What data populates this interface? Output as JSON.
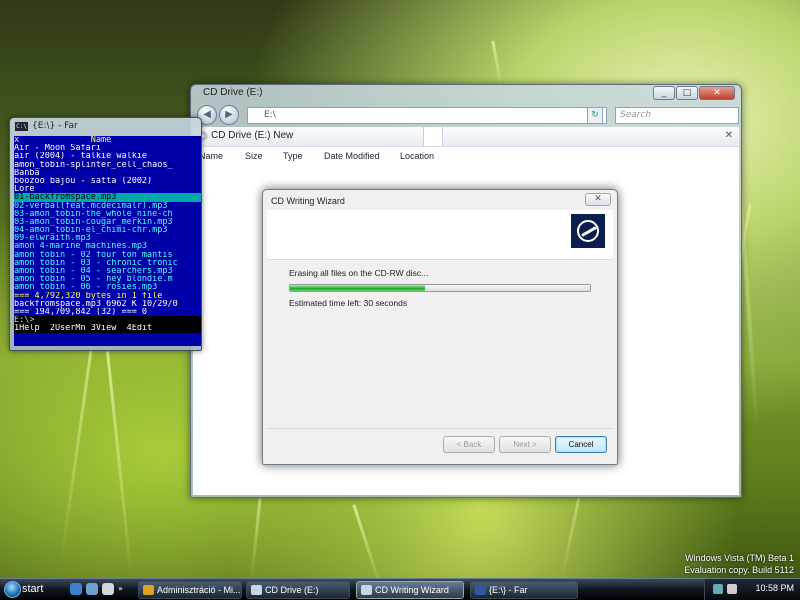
{
  "desktop": {
    "watermark_line1": "Windows Vista (TM) Beta 1",
    "watermark_line2": "Evaluation copy. Build 5112"
  },
  "explorer": {
    "title": "CD Drive (E:)",
    "address": "E:\\",
    "search_placeholder": "Search",
    "toolbar_label": "CD Drive (E:) New",
    "columns": [
      "Name",
      "Size",
      "Type",
      "Date Modified",
      "Location"
    ],
    "controls": {
      "minimize": "_",
      "maximize": "□",
      "close": "✕",
      "back": "◀",
      "forward": "▶",
      "refresh": "↻"
    }
  },
  "far": {
    "title": "{E:\\} - Far",
    "icon_text": "C:\\",
    "lines": [
      {
        "text": "x              Name           ",
        "style": "yellow"
      },
      {
        "text": "Air - Moon Safari",
        "style": "white"
      },
      {
        "text": "air (2004) - talkie walkie",
        "style": "white"
      },
      {
        "text": "amon_tobin-splinter_cell_chaos_",
        "style": "white"
      },
      {
        "text": "Banba",
        "style": "white"
      },
      {
        "text": "boozoo bajou - satta (2002)",
        "style": "white"
      },
      {
        "text": "Lore",
        "style": "white"
      },
      {
        "text": "01-backfromspace.mp3",
        "style": "sel"
      },
      {
        "text": "02-verbal(feat.mcdecimalr).mp3",
        "style": ""
      },
      {
        "text": "03-amon_tobin-the_whole_nine-ch",
        "style": ""
      },
      {
        "text": "03-amon_tobin-cougar_merkin.mp3",
        "style": ""
      },
      {
        "text": "04-amon_tobin-el_chimi-chr.mp3",
        "style": ""
      },
      {
        "text": "09-elwraith.mp3",
        "style": ""
      },
      {
        "text": "amon 4-marine machines.mp3",
        "style": ""
      },
      {
        "text": "amon tobin - 02 four ton mantis",
        "style": ""
      },
      {
        "text": "amon tobin - 03 - chronic tronic",
        "style": ""
      },
      {
        "text": "amon tobin - 04 - searchers.mp3",
        "style": ""
      },
      {
        "text": "amon tobin - 05 - hey blondie.m",
        "style": ""
      },
      {
        "text": "amon tobin - 06 - rosies.mp3",
        "style": ""
      },
      {
        "text": "=== 4,792,320 bytes in 1 file",
        "style": "yellow"
      },
      {
        "text": "backfromspace.mp3 6962 K 10/29/0",
        "style": "white"
      },
      {
        "text": "=== 194,709,842 (32) === 0",
        "style": "white"
      },
      {
        "text": "E:\\>",
        "style": "black"
      },
      {
        "text": "1Help  2UserMn 3View  4Edit  ",
        "style": "bar"
      }
    ]
  },
  "wizard": {
    "title": "CD Writing Wizard",
    "close": "✕",
    "message": "Erasing all files on the CD-RW disc...",
    "progress_fraction": 0.45,
    "eta": "Estimated time left: 30 seconds",
    "back_label": "< Back",
    "next_label": "Next >",
    "cancel_label": "Cancel"
  },
  "taskbar": {
    "start_label": "start",
    "buttons": [
      {
        "label": "Adminisztráció - Mi...",
        "color": "#d9a520"
      },
      {
        "label": "CD Drive (E:)",
        "color": "#c9d6e6"
      },
      {
        "label": "CD Writing Wizard",
        "color": "#c9d6e6",
        "active": true
      },
      {
        "label": "{E:\\} - Far",
        "color": "#2a5aa0"
      }
    ],
    "clock": "10:58 PM"
  }
}
